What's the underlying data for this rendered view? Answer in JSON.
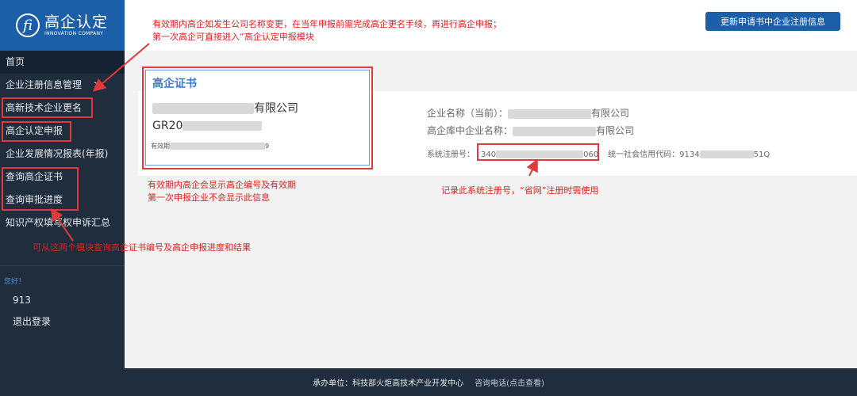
{
  "logo": {
    "mark": "fi",
    "title": "高企认定",
    "subtitle": "INNOVATION COMPANY"
  },
  "header": {
    "update_button": "更新申请书中企业注册信息"
  },
  "nav": {
    "items": [
      {
        "label": "首页"
      },
      {
        "label": "企业注册信息管理"
      },
      {
        "label": "高新技术企业更名"
      },
      {
        "label": "高企认定申报"
      },
      {
        "label": "企业发展情况报表(年报)"
      },
      {
        "label": "查询高企证书"
      },
      {
        "label": "查询审批进度"
      },
      {
        "label": "知识产权填写权申诉汇总"
      }
    ],
    "chevron": ">"
  },
  "user": {
    "greeting": "您好！",
    "id": "913",
    "logout": "退出登录"
  },
  "certificate": {
    "title": "高企证书",
    "name_suffix": "有限公司",
    "code_prefix": "GR20",
    "valid_label": "有效期",
    "valid_suffix": "9"
  },
  "company": {
    "current_name_label": "企业名称（当前）：",
    "current_name_suffix": "有限公司",
    "db_name_label": "高企库中企业名称：",
    "db_name_suffix": "有限公司",
    "reg_label": "系统注册号：",
    "reg_prefix": "340",
    "reg_suffix": "060",
    "credit_label": "统一社会信用代码：9134",
    "credit_suffix": "51Q"
  },
  "annotations": {
    "top_note_1": "有效期内高企如发生公司名称变更，在当年申报前需完成高企更名手续，再进行高企申报；",
    "top_note_2": "第一次高企可直接进入“高企认定申报模块",
    "cert_note_1": "有效期内高企会显示高企编号及有效期",
    "cert_note_2": "第一次申报企业不会显示此信息",
    "reg_note": "记录此系统注册号，“省网”注册时需使用",
    "query_note": "可从这两个模块查询高企证书编号及高企申报进度和结果"
  },
  "footer": {
    "organizer": "承办单位：科技部火炬高技术产业开发中心",
    "contact": "咨询电话(点击查看)"
  },
  "colors": {
    "accent": "#1b5fa8",
    "sidebar": "#1f2d3d",
    "annotation": "#e03a3a"
  }
}
